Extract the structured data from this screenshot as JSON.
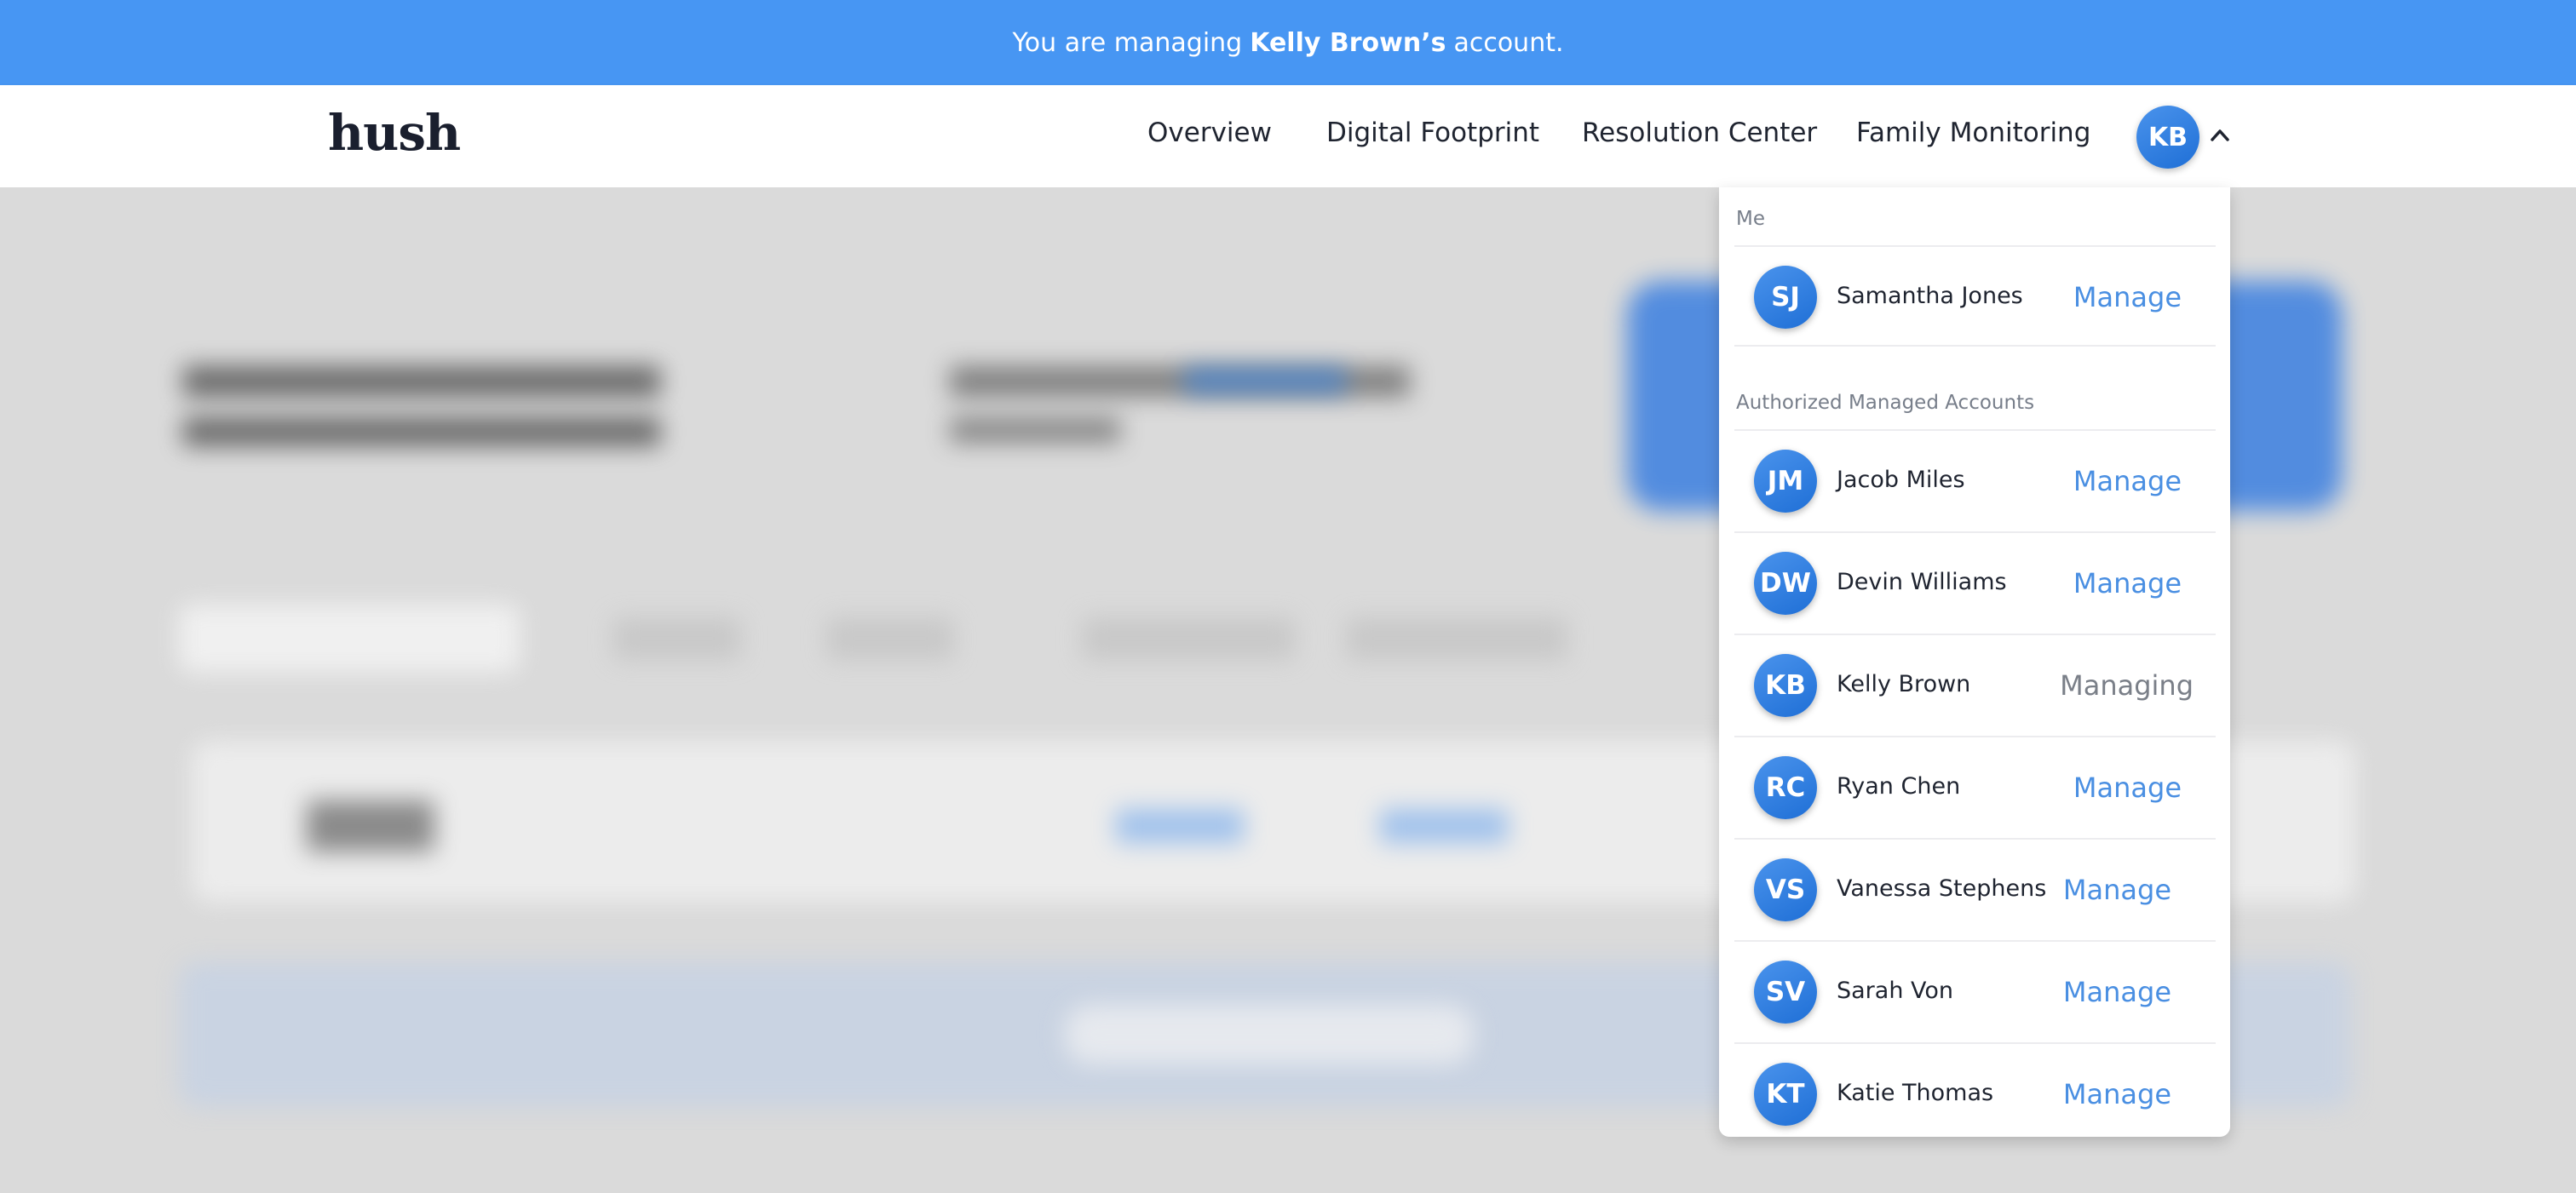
{
  "banner": {
    "prefix": "You are managing",
    "account_name": "Kelly Brown’s",
    "suffix": "account."
  },
  "navbar": {
    "logo": "hush",
    "links": [
      "Overview",
      "Digital Footprint",
      "Resolution Center",
      "Family Monitoring"
    ],
    "user_initials": "KB",
    "caret_icon": "chevron-up-icon"
  },
  "dropdown": {
    "me_label": "Me",
    "me": {
      "initials": "SJ",
      "name": "Samantha Jones",
      "action": "Manage"
    },
    "managed_label": "Authorized Managed Accounts",
    "accounts": [
      {
        "initials": "JM",
        "name": "Jacob Miles",
        "action": "Manage"
      },
      {
        "initials": "DW",
        "name": "Devin Williams",
        "action": "Manage"
      },
      {
        "initials": "KB",
        "name": "Kelly Brown",
        "action": "Managing"
      },
      {
        "initials": "RC",
        "name": "Ryan Chen",
        "action": "Manage"
      },
      {
        "initials": "VS",
        "name": "Vanessa Stephens",
        "action": "Manage"
      },
      {
        "initials": "SV",
        "name": "Sarah Von",
        "action": "Manage"
      },
      {
        "initials": "KT",
        "name": "Katie Thomas",
        "action": "Manage"
      }
    ]
  },
  "colors": {
    "banner": "#4796f3",
    "accent": "#4a8fe2",
    "avatar": "#2f80e0"
  }
}
